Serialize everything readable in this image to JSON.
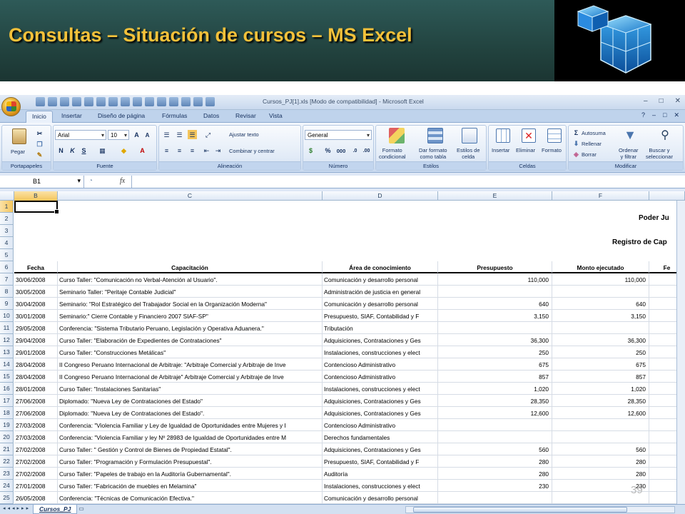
{
  "slide": {
    "title": "Consultas – Situación de cursos – MS Excel",
    "page_number": "39"
  },
  "window": {
    "caption": "Cursos_PJ[1].xls  [Modo de compatibilidad]  -  Microsoft Excel",
    "controls": [
      "–",
      "□",
      "✕"
    ]
  },
  "ribbon": {
    "tabs": [
      "Inicio",
      "Insertar",
      "Diseño de página",
      "Fórmulas",
      "Datos",
      "Revisar",
      "Vista"
    ],
    "active_tab": "Inicio",
    "groups": {
      "clipboard": {
        "label": "Portapapeles",
        "paste": "Pegar"
      },
      "font": {
        "label": "Fuente",
        "font_name": "Arial",
        "font_size": "10",
        "bold": "N",
        "italic": "K",
        "underline": "S"
      },
      "alignment": {
        "label": "Alineación",
        "wrap": "Ajustar texto",
        "merge": "Combinar y centrar"
      },
      "number": {
        "label": "Número",
        "format": "General",
        "percent": "%",
        "thousands": "000"
      },
      "styles": {
        "label": "Estilos",
        "conditional": "Formato\ncondicional",
        "as_table": "Dar formato\ncomo tabla",
        "cell_styles": "Estilos de\ncelda"
      },
      "cells": {
        "label": "Celdas",
        "insert": "Insertar",
        "delete": "Eliminar",
        "format": "Formato"
      },
      "modify": {
        "label": "Modificar",
        "autosum": "Autosuma",
        "fill": "Rellenar",
        "clear": "Borrar",
        "sort": "Ordenar\ny filtrar",
        "find": "Buscar y\nseleccionar"
      }
    }
  },
  "formula_bar": {
    "name_box": "B1",
    "fx": "fx",
    "value": ""
  },
  "sheet": {
    "columns": [
      "B",
      "C",
      "D",
      "E",
      "F",
      ""
    ],
    "selected_column": "B",
    "row_numbers": [
      "1",
      "2",
      "3",
      "4",
      "5",
      "6",
      "7",
      "8",
      "9",
      "10",
      "11",
      "12",
      "13",
      "14",
      "15",
      "16",
      "17",
      "18",
      "19",
      "20",
      "21",
      "22",
      "23",
      "24",
      "25"
    ],
    "selected_row": "1",
    "title_line_1": "Poder Ju",
    "title_line_2": "Registro de Cap",
    "headers": [
      "Fecha",
      "Capacitación",
      "Área de conocimiento",
      "Presupuesto",
      "Monto ejecutado",
      "Fe"
    ],
    "rows": [
      [
        "30/06/2008",
        "Curso Taller: \"Comunicación no Verbal-Atención al Usuario\".",
        "Comunicación y desarrollo personal",
        "110,000",
        "110,000"
      ],
      [
        "30/05/2008",
        "Seminario Taller: \"Peritaje Contable Judicial\"",
        "Administración de justicia en general",
        "",
        ""
      ],
      [
        "30/04/2008",
        "Seminario: \"Rol Estratégico del Trabajador Social en la Organización Moderna\"",
        "Comunicación y desarrollo personal",
        "640",
        "640"
      ],
      [
        "30/01/2008",
        "Seminario:\" Cierre Contable y Financiero 2007 SIAF-SP\"",
        "Presupuesto, SIAF, Contabilidad y F",
        "3,150",
        "3,150"
      ],
      [
        "29/05/2008",
        "Conferencia: \"Sistema Tributario Peruano, Legislación y Operativa Aduanera.\"",
        "Tributación",
        "",
        ""
      ],
      [
        "29/04/2008",
        "Curso Taller: \"Elaboración de Expedientes de Contrataciones\"",
        "Adquisiciones, Contrataciones y Ges",
        "36,300",
        "36,300"
      ],
      [
        "29/01/2008",
        "Curso Taller: \"Construcciones Metálicas\"",
        "Instalaciones, construcciones y elect",
        "250",
        "250"
      ],
      [
        "28/04/2008",
        "II Congreso Peruano Internacional de Arbitraje: \"Arbitraje Comercial y Arbitraje de Inve",
        "Contencioso Administrativo",
        "675",
        "675"
      ],
      [
        "28/04/2008",
        "II Congreso Peruano Internacional de Arbitraje\" Arbitraje Comercial y Arbitraje de Inve",
        "Contencioso Administrativo",
        "857",
        "857"
      ],
      [
        "28/01/2008",
        "Curso Taller: \"Instalaciones Sanitarias\"",
        "Instalaciones, construcciones y elect",
        "1,020",
        "1,020"
      ],
      [
        "27/06/2008",
        "Diplomado: \"Nueva Ley de Contrataciones del Estado\"",
        "Adquisiciones, Contrataciones y Ges",
        "28,350",
        "28,350"
      ],
      [
        "27/06/2008",
        "Diplomado: \"Nueva Ley de Contrataciones del Estado\".",
        "Adquisiciones, Contrataciones y Ges",
        "12,600",
        "12,600"
      ],
      [
        "27/03/2008",
        "Conferencia: \"Violencia Familiar y Ley de Igualdad de Oportunidades entre Mujeres y I",
        "Contencioso Administrativo",
        "",
        ""
      ],
      [
        "27/03/2008",
        "Conferencia: \"Violencia Familiar y ley Nº 28983 de Igualdad de Oportunidades entre M",
        "Derechos fundamentales",
        "",
        ""
      ],
      [
        "27/02/2008",
        "Curso Taller: \" Gestión y Control de Bienes de Propiedad Estatal\".",
        "Adquisiciones, Contrataciones y Ges",
        "560",
        "560"
      ],
      [
        "27/02/2008",
        "Curso Taller: \"Programación y Formulación Presupuestal\".",
        "Presupuesto, SIAF, Contabilidad y F",
        "280",
        "280"
      ],
      [
        "27/02/2008",
        "Curso Taller: \"Papeles de trabajo en la Auditoría Gubernamental\".",
        "Auditoría",
        "280",
        "280"
      ],
      [
        "27/01/2008",
        "Curso Taller: \"Fabricación de muebles en Melamina\"",
        "Instalaciones, construcciones y elect",
        "230",
        "230"
      ],
      [
        "26/05/2008",
        "Conferencia: \"Técnicas de Comunicación Efectiva.\"",
        "Comunicación y desarrollo personal",
        "",
        ""
      ]
    ],
    "sheet_tab": "Cursos_PJ"
  }
}
